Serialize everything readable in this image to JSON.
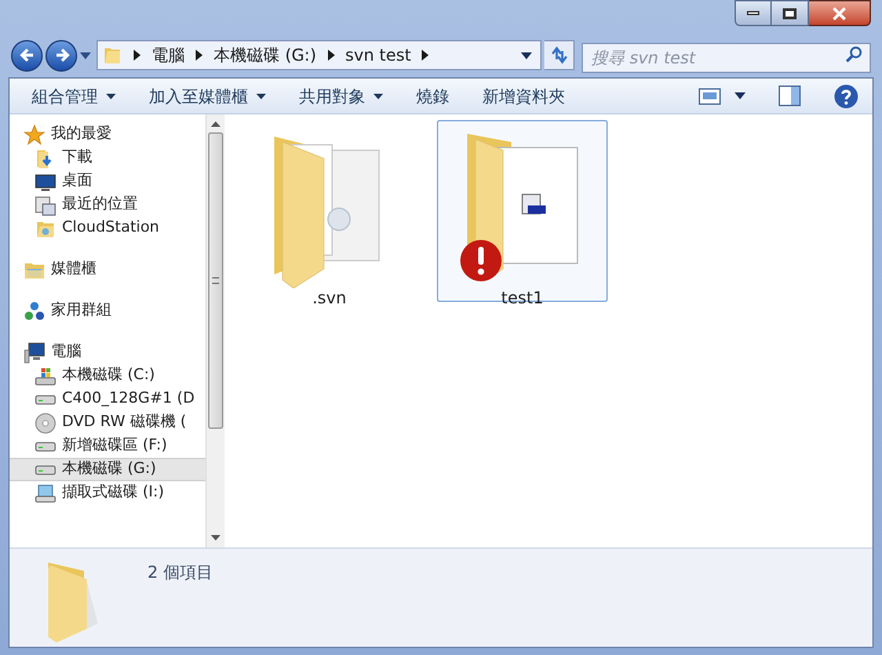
{
  "address": {
    "segments": [
      "電腦",
      "本機磁碟 (G:)",
      "svn test"
    ]
  },
  "search": {
    "placeholder": "搜尋 svn test"
  },
  "toolbar": {
    "items": [
      {
        "label": "組合管理",
        "dropdown": true
      },
      {
        "label": "加入至媒體櫃",
        "dropdown": true
      },
      {
        "label": "共用對象",
        "dropdown": true
      },
      {
        "label": "燒錄",
        "dropdown": false
      },
      {
        "label": "新增資料夾",
        "dropdown": false
      }
    ]
  },
  "nav": {
    "groups": [
      {
        "label": "我的最愛",
        "kind": "star",
        "selected": false,
        "children": [
          {
            "label": "下載",
            "kind": "download",
            "selected": false
          },
          {
            "label": "桌面",
            "kind": "desktop",
            "selected": false
          },
          {
            "label": "最近的位置",
            "kind": "recent",
            "selected": false
          },
          {
            "label": "CloudStation",
            "kind": "folder",
            "selected": false
          }
        ]
      },
      {
        "label": "媒體櫃",
        "kind": "library",
        "selected": false
      },
      {
        "label": "家用群組",
        "kind": "homegroup",
        "selected": false
      },
      {
        "label": "電腦",
        "kind": "computer",
        "selected": false,
        "children": [
          {
            "label": "本機磁碟 (C:)",
            "kind": "system-drive",
            "selected": false
          },
          {
            "label": "C400_128G#1 (D",
            "kind": "drive",
            "selected": false
          },
          {
            "label": "DVD RW 磁碟機 (",
            "kind": "dvd",
            "selected": false
          },
          {
            "label": "新增磁碟區 (F:)",
            "kind": "drive",
            "selected": false
          },
          {
            "label": "本機磁碟 (G:)",
            "kind": "drive",
            "selected": true
          },
          {
            "label": "擷取式磁碟 (I:)",
            "kind": "removable",
            "selected": false
          }
        ]
      }
    ]
  },
  "files": [
    {
      "name": ".svn",
      "kind": "svn",
      "selected": false,
      "error": false
    },
    {
      "name": "test1",
      "kind": "document",
      "selected": true,
      "error": true
    }
  ],
  "details": {
    "text": "2 個項目"
  }
}
